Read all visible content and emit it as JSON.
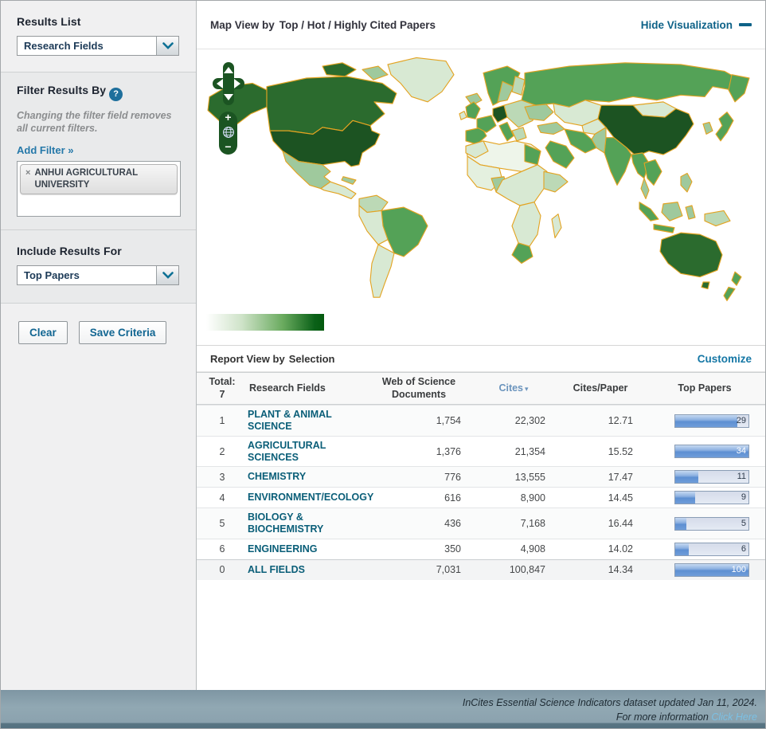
{
  "sidebar": {
    "results_list_label": "Results List",
    "results_list_value": "Research Fields",
    "filter_title": "Filter Results By",
    "filter_help": "?",
    "filter_note": "Changing the filter field removes all current filters.",
    "add_filter_label": "Add Filter »",
    "filter_tag": {
      "remove": "×",
      "label": "ANHUI AGRICULTURAL UNIVERSITY"
    },
    "include_label": "Include Results For",
    "include_value": "Top Papers",
    "clear_button": "Clear",
    "save_button": "Save Criteria"
  },
  "map_panel": {
    "title_prefix": "Map View by",
    "title_value": "Top / Hot / Highly Cited Papers",
    "hide_link": "Hide Visualization",
    "zoom_in": "+",
    "zoom_out": "−",
    "globe_icon": "globe",
    "legend": {
      "from": "#ffffff",
      "to": "#045a0e"
    },
    "palette": {
      "darkest": "#1c5322",
      "dark": "#2b6b2e",
      "medium": "#54a257",
      "light": "#9fc99d",
      "pale": "#d8e9d3",
      "faint": "#eef5ea",
      "country_border": "#e3a321"
    }
  },
  "report_panel": {
    "title_prefix": "Report View by",
    "title_value": "Selection",
    "customize_link": "Customize"
  },
  "table": {
    "total_label": "Total:",
    "total_count": "7",
    "columns": {
      "field": "Research Fields",
      "documents": "Web of Science Documents",
      "cites": "Cites",
      "cites_per_paper": "Cites/Paper",
      "top_papers": "Top Papers"
    },
    "sort": {
      "column": "Cites",
      "direction": "desc",
      "arrow": "▾"
    },
    "rows": [
      {
        "rank": "1",
        "field": "PLANT & ANIMAL SCIENCE",
        "documents": "1,754",
        "cites": "22,302",
        "cites_per_paper": "12.71",
        "top_papers": "29",
        "bar_pct": 85
      },
      {
        "rank": "2",
        "field": "AGRICULTURAL SCIENCES",
        "documents": "1,376",
        "cites": "21,354",
        "cites_per_paper": "15.52",
        "top_papers": "34",
        "bar_pct": 100
      },
      {
        "rank": "3",
        "field": "CHEMISTRY",
        "documents": "776",
        "cites": "13,555",
        "cites_per_paper": "17.47",
        "top_papers": "11",
        "bar_pct": 32
      },
      {
        "rank": "4",
        "field": "ENVIRONMENT/ECOLOGY",
        "documents": "616",
        "cites": "8,900",
        "cites_per_paper": "14.45",
        "top_papers": "9",
        "bar_pct": 27
      },
      {
        "rank": "5",
        "field": "BIOLOGY & BIOCHEMISTRY",
        "documents": "436",
        "cites": "7,168",
        "cites_per_paper": "16.44",
        "top_papers": "5",
        "bar_pct": 15
      },
      {
        "rank": "6",
        "field": "ENGINEERING",
        "documents": "350",
        "cites": "4,908",
        "cites_per_paper": "14.02",
        "top_papers": "6",
        "bar_pct": 18
      },
      {
        "rank": "0",
        "field": "ALL FIELDS",
        "documents": "7,031",
        "cites": "100,847",
        "cites_per_paper": "14.34",
        "top_papers": "100",
        "bar_pct": 100
      }
    ]
  },
  "footer": {
    "line1": "InCites Essential Science Indicators dataset updated Jan 11, 2024.",
    "line2_prefix": "For more information",
    "line2_link": "Click Here"
  }
}
